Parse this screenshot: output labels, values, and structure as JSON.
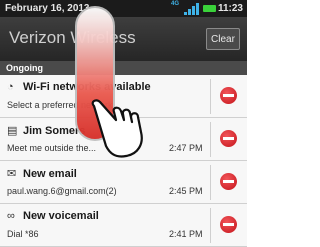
{
  "status_bar": {
    "date": "February 16, 2013",
    "time": "11:23",
    "network": "4G",
    "icons": [
      "signal-icon",
      "battery-icon"
    ]
  },
  "header": {
    "carrier": "Verizon Wireless",
    "clear_label": "Clear"
  },
  "section": {
    "label": "Ongoing"
  },
  "notifications": [
    {
      "icon": "wifi-icon",
      "title": "Wi-Fi networks available",
      "subtitle": "Select a preferred network",
      "time": ""
    },
    {
      "icon": "message-icon",
      "title": "Jim Somers",
      "subtitle": "Meet me outside the...",
      "time": "2:47 PM"
    },
    {
      "icon": "email-icon",
      "title": "New email",
      "subtitle": "paul.wang.6@gmail.com(2)",
      "time": "2:45 PM"
    },
    {
      "icon": "voicemail-icon",
      "title": "New voicemail",
      "subtitle": "Dial *86",
      "time": "2:41 PM"
    }
  ],
  "colors": {
    "remove": "#d62f2a",
    "header": "#2f2f2f",
    "section": "#4a4a4a"
  }
}
